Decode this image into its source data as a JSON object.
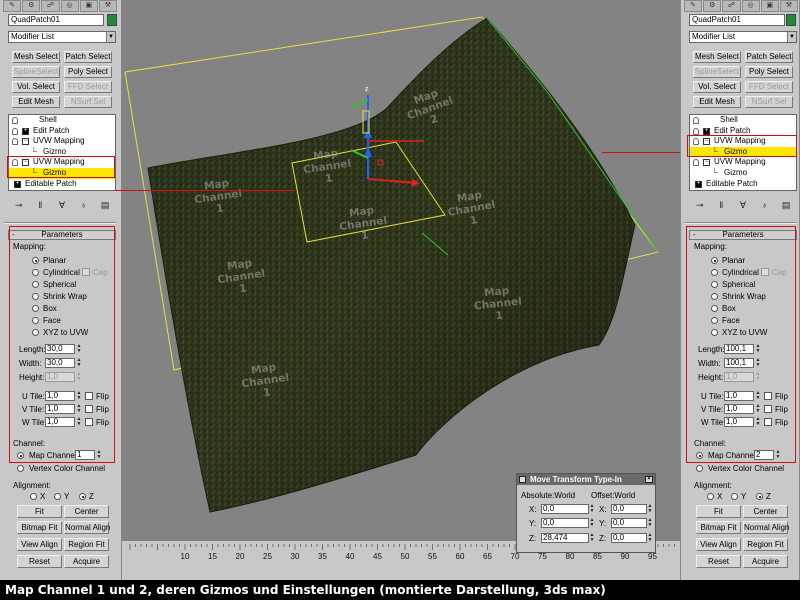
{
  "object_name": "QuadPatch01",
  "modifier_list": "Modifier List",
  "modifier_buttons": [
    {
      "label": "Mesh Select",
      "disabled": false
    },
    {
      "label": "Patch Select",
      "disabled": false
    },
    {
      "label": "SplineSelect",
      "disabled": true
    },
    {
      "label": "Poly Select",
      "disabled": false
    },
    {
      "label": "Vol. Select",
      "disabled": false
    },
    {
      "label": "FFD Select",
      "disabled": true
    },
    {
      "label": "Edit Mesh",
      "disabled": false
    },
    {
      "label": "NSurf Sel",
      "disabled": true
    }
  ],
  "stack": [
    "Shell",
    "Edit Patch",
    "UVW Mapping",
    "Gizmo",
    "UVW Mapping",
    "Gizmo",
    "Editable Patch"
  ],
  "parameters": {
    "rollout_title": "Parameters",
    "minus": "-",
    "mapping_label": "Mapping:",
    "mapping_options": [
      "Planar",
      "Cylindrical",
      "Spherical",
      "Shrink Wrap",
      "Box",
      "Face",
      "XYZ to UVW"
    ],
    "cap_label": "Cap",
    "length_label": "Length:",
    "width_label": "Width:",
    "height_label": "Height:",
    "utile_label": "U Tile:",
    "vtile_label": "V Tile:",
    "wtile_label": "W Tile:",
    "flip_label": "Flip",
    "channel_label": "Channel:",
    "map_channel_label": "Map Channel:",
    "vertex_color_label": "Vertex Color Channel",
    "alignment_label": "Alignment:",
    "axes": [
      "X",
      "Y",
      "Z"
    ],
    "buttons": [
      "Fit",
      "Center",
      "Bitmap Fit",
      "Normal Align",
      "View Align",
      "Region Fit",
      "Reset",
      "Acquire"
    ]
  },
  "left_values": {
    "length": "30,0",
    "width": "30,0",
    "height": "1,0",
    "u_tile": "1,0",
    "v_tile": "1,0",
    "w_tile": "1,0",
    "map_channel": "1"
  },
  "right_values": {
    "length": "100,1",
    "width": "100,1",
    "height": "1,0",
    "u_tile": "1,0",
    "v_tile": "1,0",
    "w_tile": "1,0",
    "map_channel": "2"
  },
  "viewport": {
    "map_labels": [
      [
        "Map",
        "Channel",
        "2"
      ],
      [
        "Map",
        "Channel",
        "1"
      ],
      [
        "Map",
        "Channel",
        "1"
      ],
      [
        "Map",
        "Channel",
        "1"
      ],
      [
        "Map",
        "Channel",
        "1"
      ],
      [
        "Map",
        "Channel",
        "1"
      ],
      [
        "Map",
        "Channel",
        "1"
      ],
      [
        "Map",
        "Channel",
        "1"
      ]
    ],
    "gizmo_axis_z": "z",
    "ruler_ticks": [
      "10",
      "15",
      "20",
      "25",
      "30",
      "35",
      "40",
      "45",
      "50",
      "55",
      "60",
      "65",
      "70",
      "75",
      "80",
      "85",
      "90",
      "95"
    ]
  },
  "move_transform": {
    "title": "Move Transform Type-In",
    "absolute_label": "Absolute:World",
    "offset_label": "Offset:World",
    "absolute": {
      "x": "0,0",
      "y": "0,0",
      "z": "28,474"
    },
    "offset": {
      "x": "0,0",
      "y": "0,0",
      "z": "0,0"
    },
    "axis_labels": [
      "X:",
      "Y:",
      "Z:"
    ]
  },
  "caption": "Map Channel 1 und 2, deren Gizmos und Einstellungen (montierte Darstellung, 3ds max)",
  "colors": {
    "object_color": "#1e8a3a",
    "selection_yellow": "#ffe600",
    "highlight_red": "#d01010",
    "viewport_bg": "#838383",
    "gizmo_yellow": "#e8e040"
  }
}
